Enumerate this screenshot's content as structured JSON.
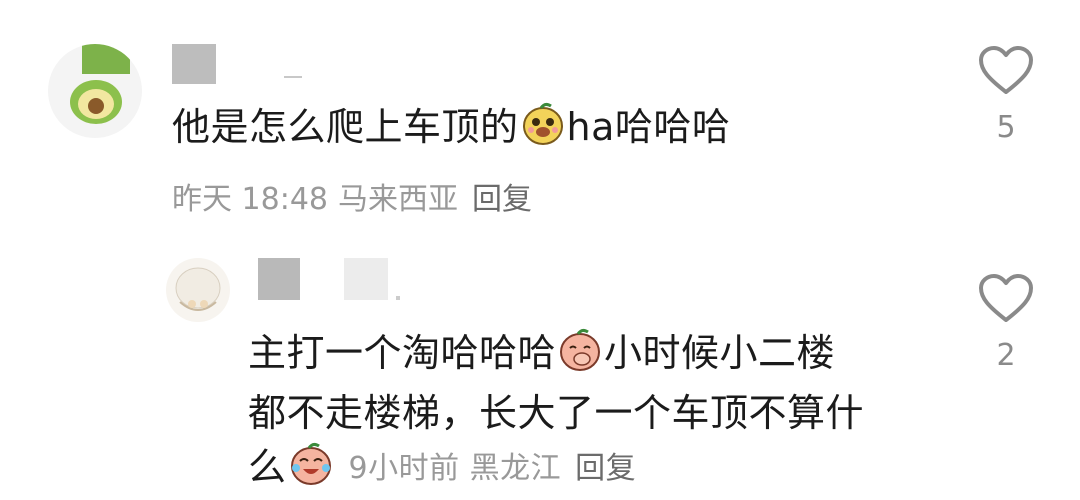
{
  "comments": [
    {
      "text_before": "他是怎么爬上车顶的",
      "emoji": "mango-doge-emoji",
      "text_after": "ha哈哈哈",
      "time": "昨天 18:48",
      "location": "马来西亚",
      "reply_label": "回复",
      "like_count": "5",
      "avatar_icon": "avocado-avatar"
    },
    {
      "line1_before": "主打一个淘哈哈哈",
      "line1_emoji": "peach-cover-mouth-emoji",
      "line1_after": "小时候小二楼",
      "line2": "都不走楼梯，长大了一个车顶不算什",
      "line3": "么",
      "line3_emoji": "peach-laugh-cry-emoji",
      "time": "9小时前",
      "location": "黑龙江",
      "reply_label": "回复",
      "like_count": "2",
      "avatar_icon": "sketch-avatar"
    }
  ]
}
